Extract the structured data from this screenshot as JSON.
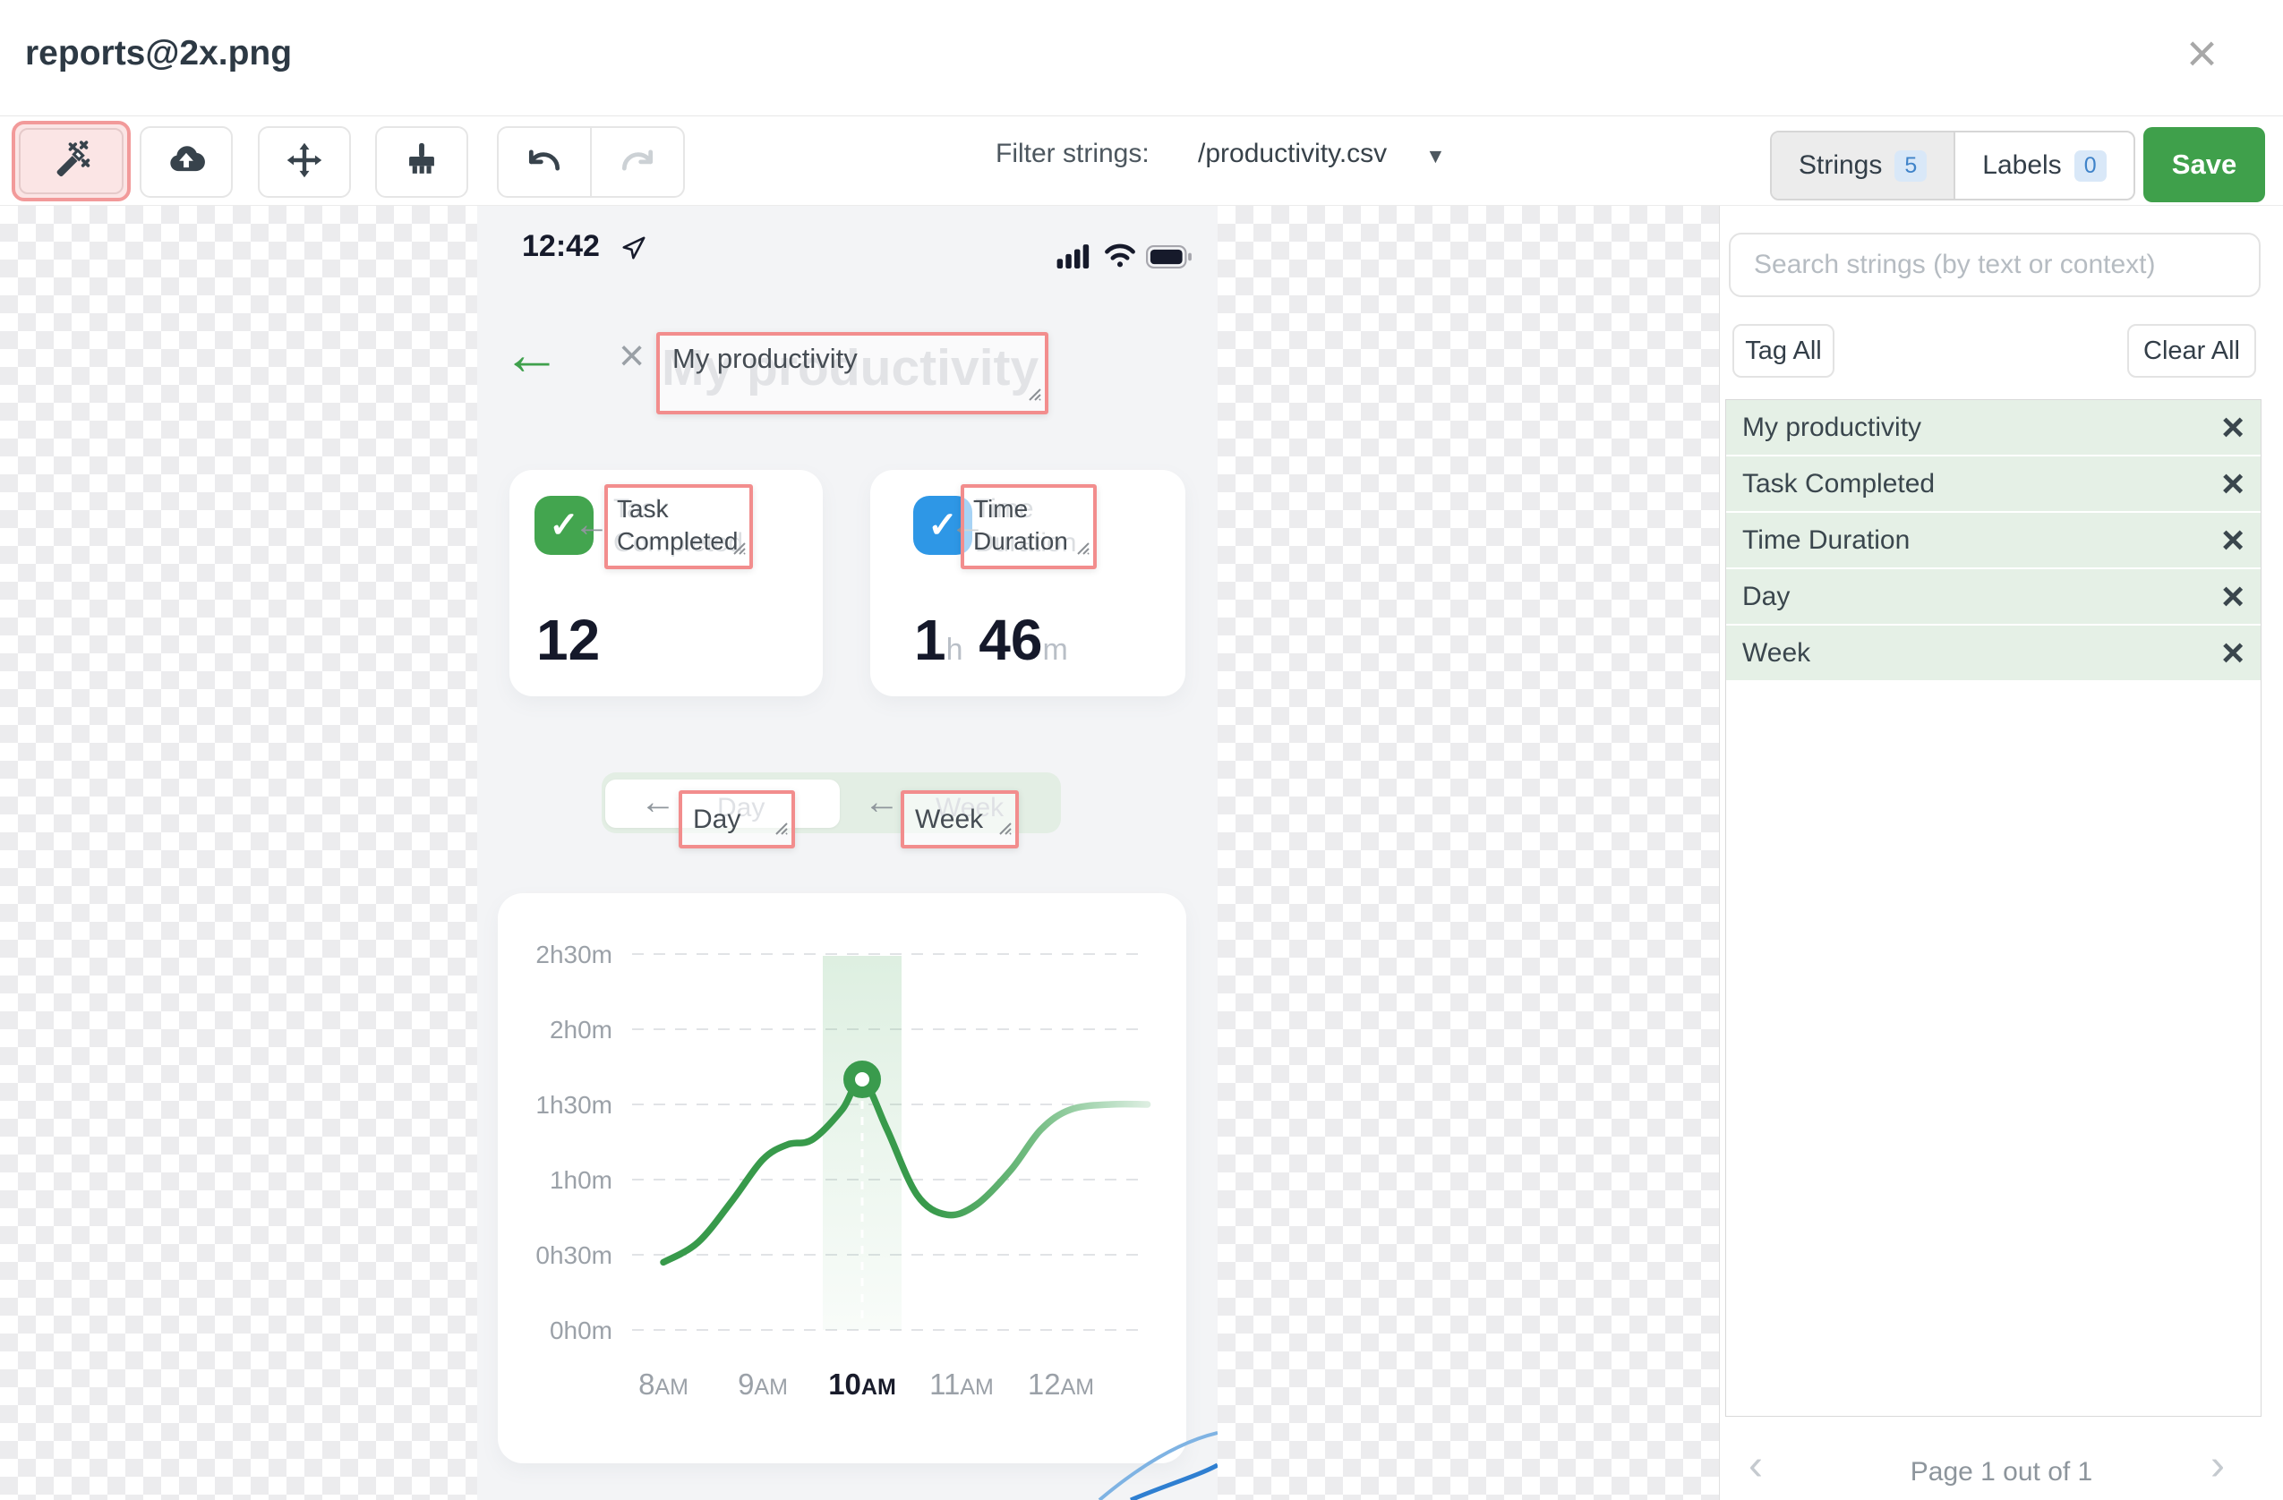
{
  "window": {
    "title": "reports@2x.png"
  },
  "toolbar": {
    "filter_label": "Filter strings:",
    "filter_value": "/productivity.csv",
    "icons": [
      "magic-wand-icon",
      "cloud-upload-icon",
      "move-icon",
      "brush-icon",
      "undo-icon",
      "redo-icon"
    ],
    "tabs": {
      "strings": {
        "label": "Strings",
        "count": "5"
      },
      "labels": {
        "label": "Labels",
        "count": "0"
      }
    },
    "save_label": "Save"
  },
  "phone": {
    "status": {
      "time": "12:42"
    },
    "heading": {
      "ghost": "My productivity",
      "tag": "My productivity"
    },
    "cards": [
      {
        "tag": "Task Completed",
        "ghost": "Task Completed",
        "value": "12"
      },
      {
        "tag": "Time Duration",
        "ghost": "Time Duration",
        "value_h": "1",
        "unit_h": "h",
        "value_m": "46",
        "unit_m": "m"
      }
    ],
    "toggle": {
      "day": {
        "tag": "Day",
        "ghost": "Day"
      },
      "week": {
        "tag": "Week",
        "ghost": "Week"
      }
    }
  },
  "chart_data": {
    "type": "line",
    "title": "",
    "xlabel": "",
    "ylabel": "",
    "x_tick_labels": [
      "8AM",
      "9AM",
      "10AM",
      "11AM",
      "12AM"
    ],
    "y_tick_labels": [
      "2h30m",
      "2h0m",
      "1h30m",
      "1h0m",
      "0h30m",
      "0h0m"
    ],
    "y_tick_minutes": [
      150,
      120,
      90,
      60,
      30,
      0
    ],
    "ylim_minutes": [
      0,
      150
    ],
    "grid": "dashed-horizontal",
    "selected_x_label": "10AM",
    "selected_point_hour_min": [
      10,
      100
    ],
    "highlight_band_center": "10AM",
    "line_color": "#3a9b4d",
    "series": [
      {
        "name": "time-duration-by-hour",
        "points_hour_min": [
          [
            8.0,
            27
          ],
          [
            8.35,
            35
          ],
          [
            8.7,
            52
          ],
          [
            9.0,
            68
          ],
          [
            9.25,
            74
          ],
          [
            9.5,
            76
          ],
          [
            9.8,
            88
          ],
          [
            10.0,
            100
          ],
          [
            10.25,
            80
          ],
          [
            10.55,
            54
          ],
          [
            10.85,
            46
          ],
          [
            11.15,
            50
          ],
          [
            11.5,
            64
          ],
          [
            11.8,
            80
          ],
          [
            12.1,
            88
          ],
          [
            12.5,
            90
          ],
          [
            12.87,
            90
          ]
        ]
      }
    ]
  },
  "sidebar": {
    "search_placeholder": "Search strings (by text or context)",
    "tag_all": "Tag All",
    "clear_all": "Clear All",
    "strings": [
      "My productivity",
      "Task Completed",
      "Time Duration",
      "Day",
      "Week"
    ],
    "pagination": "Page 1 out of 1"
  }
}
